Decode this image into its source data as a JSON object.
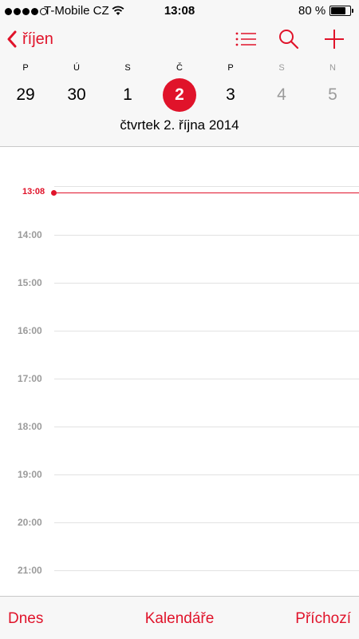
{
  "status_bar": {
    "carrier": "T-Mobile CZ",
    "time": "13:08",
    "battery_percent": "80 %",
    "battery_level": 0.8,
    "signal_bars_filled": 4,
    "signal_bars_total": 5
  },
  "nav": {
    "back_label": "říjen",
    "icons": [
      "chevron-left-icon",
      "list-icon",
      "search-icon",
      "plus-icon"
    ]
  },
  "week": {
    "days": [
      {
        "letter": "P",
        "num": "29"
      },
      {
        "letter": "Ú",
        "num": "30"
      },
      {
        "letter": "S",
        "num": "1"
      },
      {
        "letter": "Č",
        "num": "2"
      },
      {
        "letter": "P",
        "num": "3"
      },
      {
        "letter": "S",
        "num": "4"
      },
      {
        "letter": "N",
        "num": "5"
      }
    ],
    "selected_index": 3
  },
  "date_title": "čtvrtek  2. října 2014",
  "timeline": {
    "now_label": "13:08",
    "hours": [
      "14:00",
      "15:00",
      "16:00",
      "17:00",
      "18:00",
      "19:00",
      "20:00",
      "21:00"
    ]
  },
  "toolbar": {
    "today": "Dnes",
    "calendars": "Kalendáře",
    "inbox": "Příchozí"
  },
  "colors": {
    "accent": "#e0132a",
    "weekend_gray": "#9b9b9b"
  }
}
